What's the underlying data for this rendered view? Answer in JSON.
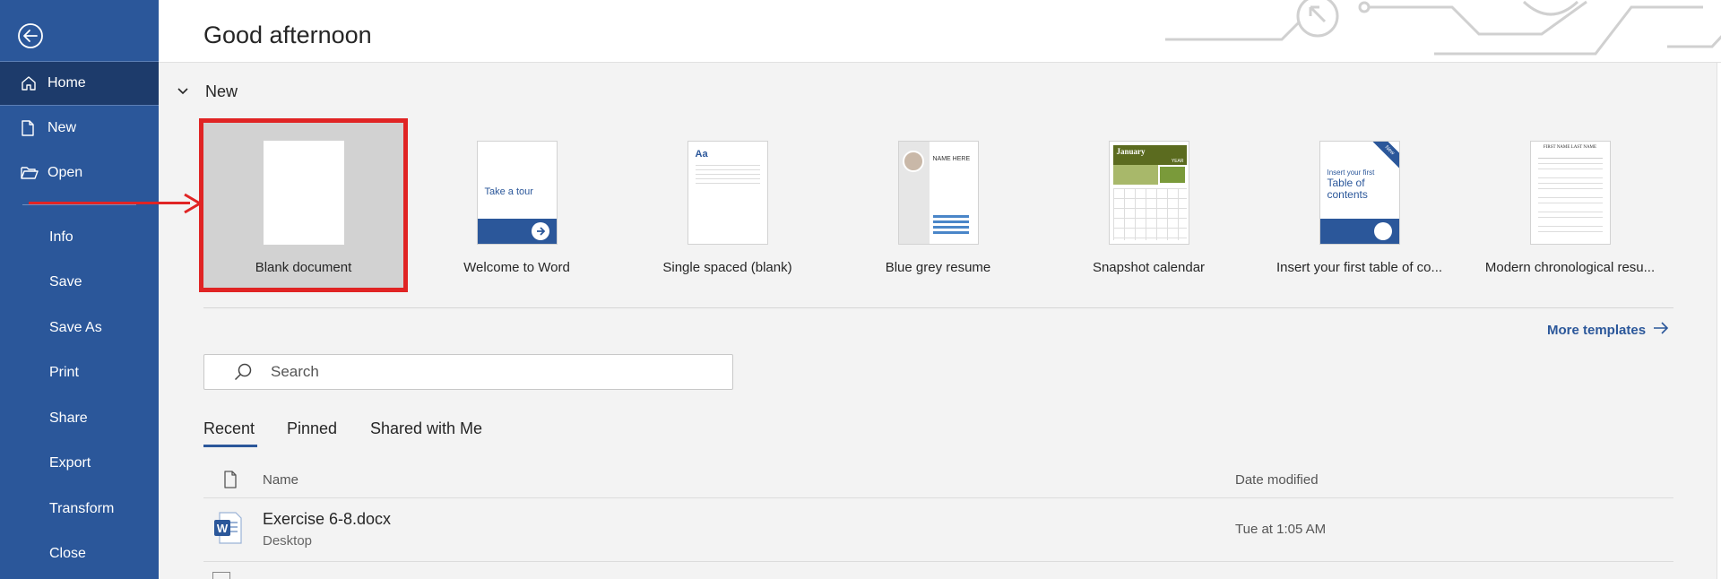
{
  "sidebar": {
    "items": [
      {
        "label": "Home",
        "icon": "home-icon"
      },
      {
        "label": "New",
        "icon": "new-document-icon"
      },
      {
        "label": "Open",
        "icon": "folder-open-icon"
      },
      {
        "label": "Info"
      },
      {
        "label": "Save"
      },
      {
        "label": "Save As"
      },
      {
        "label": "Print"
      },
      {
        "label": "Share"
      },
      {
        "label": "Export"
      },
      {
        "label": "Transform"
      },
      {
        "label": "Close"
      }
    ],
    "active": "Home"
  },
  "header": {
    "greeting": "Good afternoon"
  },
  "new_section": {
    "title": "New",
    "templates": [
      {
        "label": "Blank document",
        "selected": true
      },
      {
        "label": "Welcome to Word",
        "thumb_text": "Take a tour"
      },
      {
        "label": "Single spaced (blank)",
        "thumb_text": "Aa"
      },
      {
        "label": "Blue grey resume",
        "thumb_text": "NAME HERE"
      },
      {
        "label": "Snapshot calendar",
        "thumb_text": "January",
        "thumb_sub": "YEAR"
      },
      {
        "label": "Insert your first table of co...",
        "thumb_text": "Insert your first",
        "thumb_big": "Table of contents",
        "thumb_badge": "New"
      },
      {
        "label": "Modern chronological resu...",
        "thumb_text": "FIRST NAME LAST NAME"
      }
    ],
    "more_templates": "More templates"
  },
  "search": {
    "placeholder": "Search"
  },
  "tabs": [
    {
      "label": "Recent",
      "active": true
    },
    {
      "label": "Pinned"
    },
    {
      "label": "Shared with Me"
    }
  ],
  "files_table": {
    "headers": {
      "name": "Name",
      "date": "Date modified"
    },
    "rows": [
      {
        "name": "Exercise 6-8.docx",
        "location": "Desktop",
        "date": "Tue at 1:05 AM"
      }
    ]
  },
  "colors": {
    "sidebar": "#2b579a",
    "sidebar_active": "#1d3b6b",
    "annotation": "#e02424",
    "accent": "#2b579a"
  }
}
